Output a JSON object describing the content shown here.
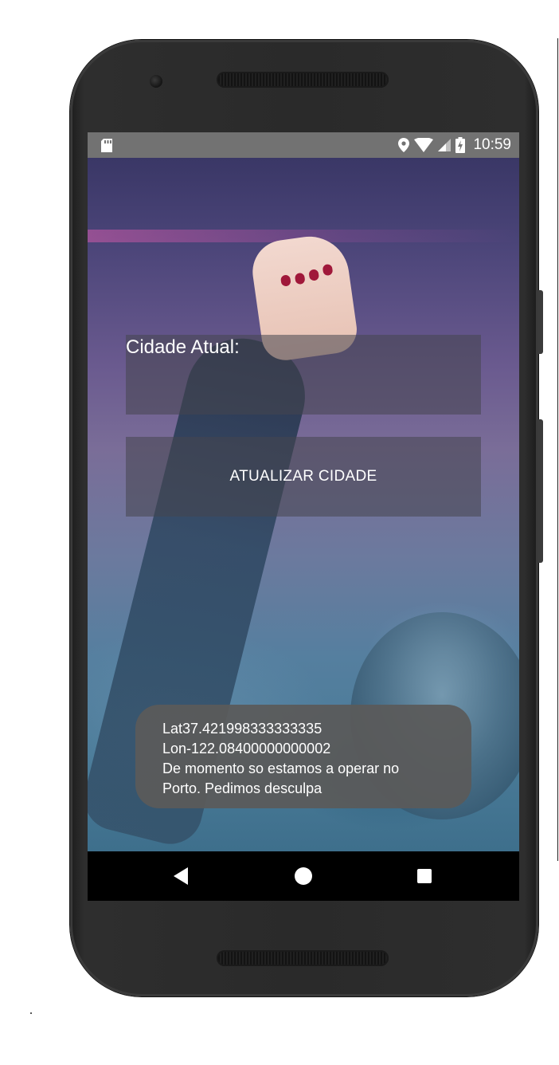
{
  "status_bar": {
    "time": "10:59",
    "icons": [
      "sd-card-icon",
      "location-icon",
      "wifi-icon",
      "cell-signal-icon",
      "battery-charging-icon"
    ]
  },
  "main": {
    "cidade_label": "Cidade Atual:",
    "update_button_label": "ATUALIZAR CIDADE"
  },
  "toast": {
    "lines": [
      "Lat37.421998333333335",
      "Lon-122.08400000000002",
      "De momento so estamos a operar no",
      "Porto. Pedimos desculpa"
    ]
  },
  "nav_bar": {
    "icons": [
      "back-icon",
      "home-icon",
      "recents-icon"
    ]
  },
  "colors": {
    "status_bar": "#727272",
    "panel": "rgba(70,70,78,0.55)",
    "toast": "#5a5a5a",
    "nav_bar": "#000000"
  }
}
